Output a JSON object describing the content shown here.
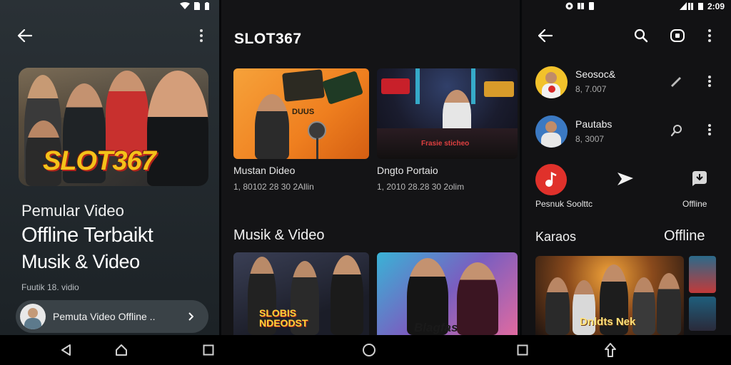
{
  "left": {
    "hero_logo": "SLOT367",
    "headline_line1": "Pemular Video",
    "headline_line2": "Offline Terbaikt",
    "headline_line3": "Musik & Video",
    "caption": "Fuutik 18. vidio",
    "player_label": "Pemuta Video Offline ..",
    "icons": [
      "back-arrow-icon",
      "more-vertical-icon",
      "chevron-right-icon"
    ]
  },
  "mid": {
    "app_title": "SLOT367",
    "cards": [
      {
        "title": "Mustan Dideo",
        "meta": "1, 80102 28 30 2Allin",
        "overlay": "DUUS"
      },
      {
        "title": "Dngto Portaio",
        "meta": "1, 2010 28.28 30 2olim",
        "overlay": "Frasie sticheo"
      }
    ],
    "section_title": "Musik & Video",
    "bottom_cards": [
      {
        "overlay": "SLOBIS NDEODST"
      },
      {
        "overlay": "Blagfas"
      }
    ]
  },
  "right": {
    "status_right": "2:09",
    "list": [
      {
        "title": "Seosoc&",
        "sub": "8, 7.007"
      },
      {
        "title": "Pautabs",
        "sub": "8, 3007"
      }
    ],
    "actions": [
      {
        "label": "Pesnuk Soolttc"
      },
      {
        "label": ""
      },
      {
        "label": "Offline"
      }
    ],
    "section_left": "Karaos",
    "section_right": "Offline",
    "banner_text": "Dnldts Nek"
  },
  "colors": {
    "accent_red": "#e0312b",
    "logo_yellow": "#f4c21a",
    "logo_orange": "#ef6a1c",
    "bg_dark": "#141416"
  }
}
